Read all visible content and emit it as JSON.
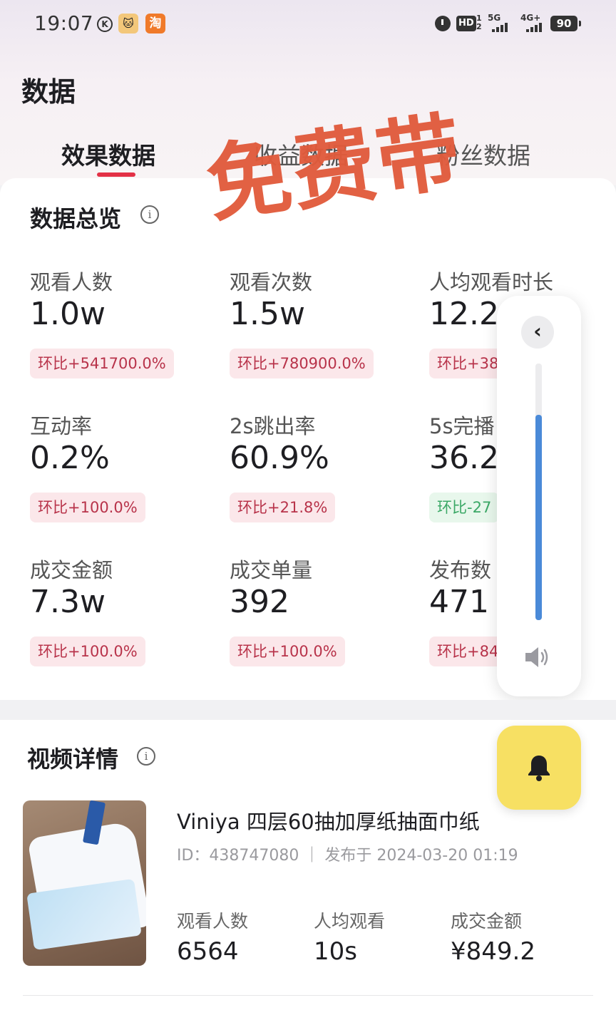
{
  "status_bar": {
    "time": "19:07",
    "k_label": "K",
    "app1_label": "🐱",
    "app2_label": "淘",
    "hd_label": "HD",
    "hd_sub": "1 2",
    "net1": "5G",
    "net2": "4G+",
    "battery": "90"
  },
  "header": {
    "title": "数据",
    "tabs": [
      {
        "label": "效果数据",
        "active": true
      },
      {
        "label": "收益数据",
        "active": false
      },
      {
        "label": "粉丝数据",
        "active": false
      }
    ]
  },
  "watermark": "免费带",
  "overview": {
    "title": "数据总览",
    "info": "i",
    "metrics": [
      {
        "label": "观看人数",
        "value": "1.0w",
        "change": "环比+541700.0%",
        "trend": "up"
      },
      {
        "label": "观看次数",
        "value": "1.5w",
        "change": "环比+780900.0%",
        "trend": "up"
      },
      {
        "label": "人均观看时长",
        "value": "12.2s",
        "change": "环比+38",
        "trend": "up"
      },
      {
        "label": "互动率",
        "value": "0.2%",
        "change": "环比+100.0%",
        "trend": "up"
      },
      {
        "label": "2s跳出率",
        "value": "60.9%",
        "change": "环比+21.8%",
        "trend": "up"
      },
      {
        "label": "5s完播",
        "value": "36.2",
        "change": "环比-27",
        "trend": "down"
      },
      {
        "label": "成交金额",
        "value": "7.3w",
        "change": "环比+100.0%",
        "trend": "up"
      },
      {
        "label": "成交单量",
        "value": "392",
        "change": "环比+100.0%",
        "trend": "up"
      },
      {
        "label": "发布数",
        "value": "471",
        "change": "环比+84",
        "trend": "up"
      }
    ]
  },
  "volume_panel": {
    "back_icon": "‹",
    "level": 0.8
  },
  "video_details": {
    "title": "视频详情",
    "info": "i",
    "item": {
      "name": "Viniya 四层60抽加厚纸抽面巾纸",
      "meta": "ID：438747080 ｜ 发布于 2024-03-20 01:19",
      "stats": [
        {
          "label": "观看人数",
          "value": "6564"
        },
        {
          "label": "人均观看",
          "value": "10s"
        },
        {
          "label": "成交金额",
          "value": "¥849.2"
        }
      ]
    }
  },
  "colors": {
    "accent": "#e33146",
    "badge_up_bg": "#fbe7ea",
    "badge_up_text": "#b8334a",
    "badge_down_bg": "#e8f7ec",
    "badge_down_text": "#3ba866",
    "volume_fill": "#4a8ad8",
    "bell_button": "#f7e063",
    "watermark": "#e15b3c"
  },
  "icons": [
    "k-icon",
    "alarm-icon",
    "signal-icon",
    "battery-icon",
    "info-icon",
    "back-chevron-icon",
    "speaker-icon",
    "bell-icon"
  ]
}
